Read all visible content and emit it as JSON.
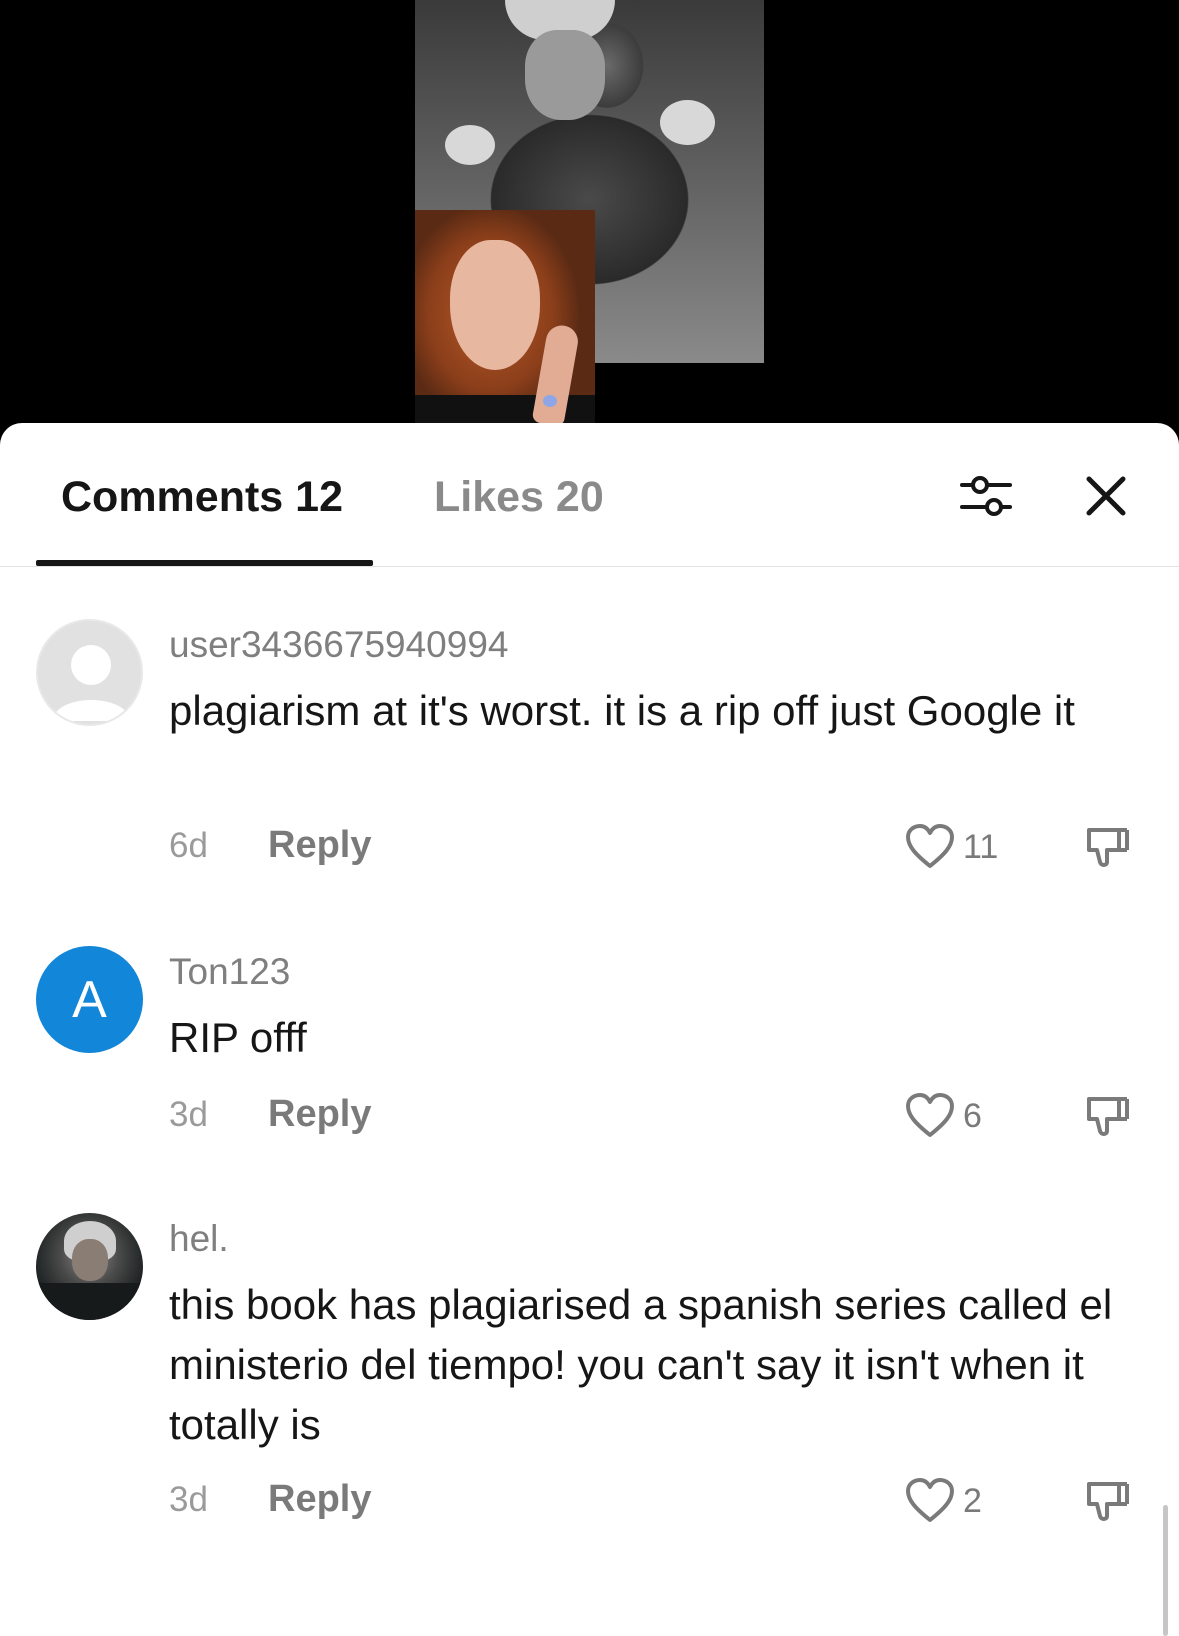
{
  "tabs": {
    "comments_label": "Comments 12",
    "likes_label": "Likes 20"
  },
  "icons": {
    "filter": "sliders-icon",
    "close": "close-icon",
    "like": "heart-icon",
    "dislike": "thumbs-down-icon"
  },
  "colors": {
    "letter_avatar": "#1286d8",
    "active_tab_underline": "#161616"
  },
  "comments": [
    {
      "username": "user3436675940994",
      "text": "plagiarism at it's worst. it is a rip off just Google it",
      "time": "6d",
      "reply_label": "Reply",
      "likes": "11"
    },
    {
      "username": "Ton123",
      "avatar_letter": "A",
      "text": "RIP offf",
      "time": "3d",
      "reply_label": "Reply",
      "likes": "6"
    },
    {
      "username": "hel.",
      "text": "this book has plagiarised a spanish series called el ministerio del tiempo! you can't say it isn't when it totally is",
      "time": "3d",
      "reply_label": "Reply",
      "likes": "2"
    }
  ]
}
